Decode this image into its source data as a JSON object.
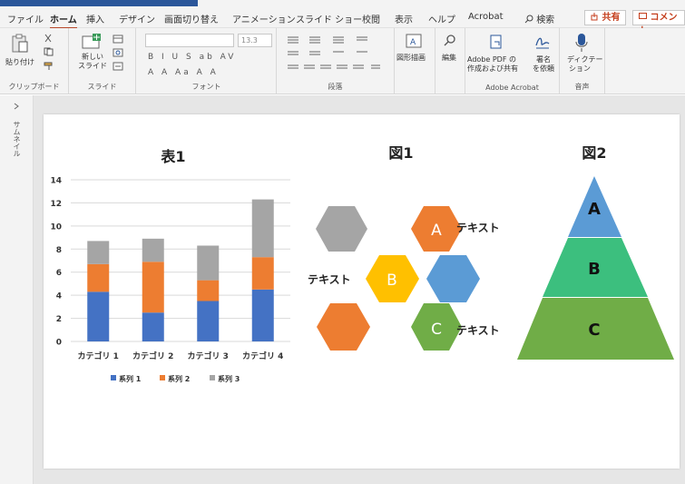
{
  "tabs": [
    "ファイル",
    "ホーム",
    "挿入",
    "デザイン",
    "画面切り替え",
    "アニメーション",
    "スライド ショー",
    "校閲",
    "表示",
    "ヘルプ",
    "Acrobat"
  ],
  "active_tab": "ホーム",
  "search_label": "検索",
  "share_label": "共有",
  "comment_label": "コメント",
  "ribbon": {
    "clipboard": {
      "paste_label": "貼り付け",
      "group_label": "クリップボード"
    },
    "slides": {
      "new_slide_label_1": "新しい",
      "new_slide_label_2": "スライド",
      "group_label": "スライド"
    },
    "font": {
      "size_value": "13.3",
      "group_label": "フォント",
      "format_row_1": "B I U S ab AV",
      "format_row_2": "A A Aa A A"
    },
    "paragraph": {
      "group_label": "段落"
    },
    "drawing": {
      "label": "図形描画"
    },
    "editing": {
      "label": "編集"
    },
    "acrobat": {
      "pdf_label_1": "Adobe PDF の",
      "pdf_label_2": "作成および共有",
      "sign_label_1": "署名",
      "sign_label_2": "を依頼",
      "group_label": "Adobe Acrobat"
    },
    "voice": {
      "dictate_label_1": "ディクテー",
      "dictate_label_2": "ション",
      "group_label": "音声"
    }
  },
  "side_panel": {
    "label": "サムネイル"
  },
  "slide": {
    "chart_title": "表1",
    "figure1_title": "図1",
    "figure2_title": "図2",
    "hex_labels": {
      "a": "A",
      "b": "B",
      "c": "C"
    },
    "hex_texts": {
      "t1": "テキスト",
      "t2": "テキスト",
      "t3": "テキスト"
    },
    "pyramid_labels": {
      "a": "A",
      "b": "B",
      "c": "C"
    }
  },
  "colors": {
    "accent": "#2b579a",
    "series1": "#4472c4",
    "series2": "#ed7d31",
    "series3": "#a5a5a5",
    "hex_gray": "#a5a5a5",
    "hex_orange": "#ed7d31",
    "hex_yellow": "#ffc000",
    "hex_blue": "#5b9bd5",
    "hex_green": "#70ad47",
    "pyramid_top": "#5b9bd5",
    "pyramid_mid": "#3cbf7e",
    "pyramid_bot": "#70ad47"
  },
  "chart_data": {
    "type": "bar",
    "stacked": true,
    "title": "表1",
    "categories": [
      "カテゴリ 1",
      "カテゴリ 2",
      "カテゴリ 3",
      "カテゴリ 4"
    ],
    "series": [
      {
        "name": "系列 1",
        "values": [
          4.3,
          2.5,
          3.5,
          4.5
        ]
      },
      {
        "name": "系列 2",
        "values": [
          2.4,
          4.4,
          1.8,
          2.8
        ]
      },
      {
        "name": "系列 3",
        "values": [
          2.0,
          2.0,
          3.0,
          5.0
        ]
      }
    ],
    "ylim": [
      0,
      14
    ],
    "yticks": [
      "0",
      "2",
      "4",
      "6",
      "8",
      "10",
      "12",
      "14"
    ],
    "grid": true,
    "legend": "bottom"
  }
}
